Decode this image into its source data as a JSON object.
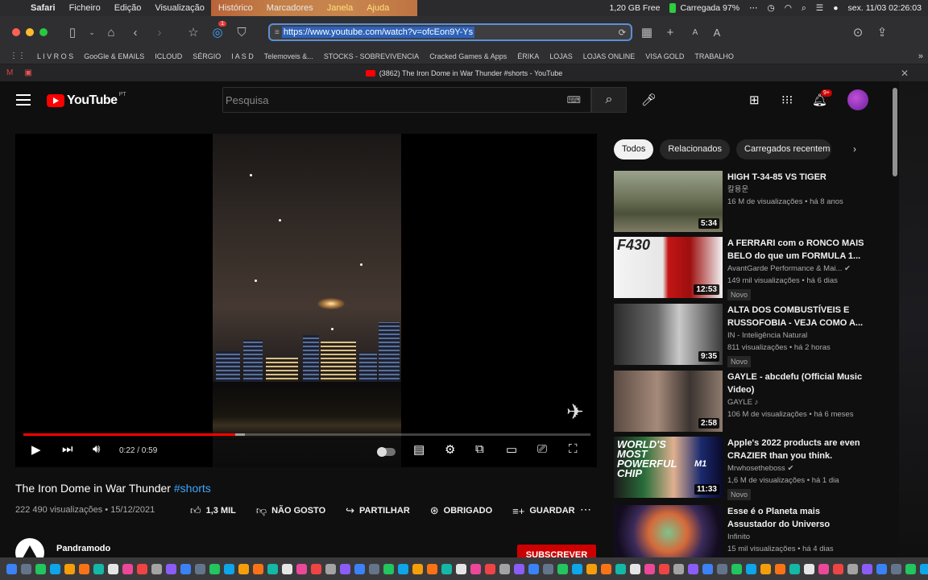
{
  "menubar": {
    "items": [
      "Safari",
      "Ficheiro",
      "Edição",
      "Visualização",
      "Histórico",
      "Marcadores",
      "Janela",
      "Ajuda"
    ],
    "memory": "1,20 GB Free",
    "battery": "Carregada 97%",
    "datetime": "sex. 11/03  02:26:03"
  },
  "toolbar": {
    "url": "https://www.youtube.com/watch?v=ofcEon9Y-Ys",
    "font_small": "A",
    "font_large": "A"
  },
  "bookmarks": [
    "L I V R O S",
    "GooGle & EMAILS",
    "ICLOUD",
    "SÉRGIO",
    "I A S D",
    "Telemoveis &...",
    "STOCKS - SOBREVIVENCIA",
    "Cracked Games & Apps",
    "ÉRIKA",
    "LOJAS",
    "LOJAS ONLINE",
    "VISA GOLD",
    "TRABALHO"
  ],
  "tab": {
    "title": "(3862) The Iron Dome in War Thunder #shorts - YouTube"
  },
  "yt": {
    "logo_text": "YouTube",
    "region": "PT",
    "search_placeholder": "Pesquisa",
    "notif_count": "9+"
  },
  "player": {
    "time": "0:22 / 0:59",
    "progress_played": 0.373,
    "progress_buffered": 0.39
  },
  "video": {
    "title": "The Iron Dome in War Thunder",
    "hashtag": "#shorts",
    "meta": "222 490 visualizações • 15/12/2021",
    "likes": "1,3 MIL",
    "dislike": "NÃO GOSTO",
    "share": "PARTILHAR",
    "thanks": "OBRIGADO",
    "save": "GUARDAR",
    "channel": "Pandramodo",
    "subscribe": "SUBSCREVER"
  },
  "chips": [
    "Todos",
    "Relacionados",
    "Carregados recentem"
  ],
  "recommendations": [
    {
      "title": "HIGH T-34-85 VS TIGER",
      "channel": "칼용운",
      "stats": "16 M de visualizações • há 8 anos",
      "duration": "5:34",
      "new": ""
    },
    {
      "title": "A FERRARI com o RONCO MAIS BELO do que um FORMULA 1...",
      "channel": "AvantGarde Performance & Mai... ✔",
      "stats": "149 mil visualizações • há 6 dias",
      "duration": "12:53",
      "new": "Novo",
      "thumb_text": "F430"
    },
    {
      "title": "ALTA DOS COMBUSTÍVEIS E RUSSOFOBIA - VEJA COMO A...",
      "channel": "IN - Inteligência Natural",
      "stats": "811 visualizações • há 2 horas",
      "duration": "9:35",
      "new": "Novo"
    },
    {
      "title": "GAYLE - abcdefu (Official Music Video)",
      "channel": "GAYLE ♪",
      "stats": "106 M de visualizações • há 6 meses",
      "duration": "2:58",
      "new": ""
    },
    {
      "title": "Apple's 2022 products are even CRAZIER than you think.",
      "channel": "Mrwhosetheboss ✔",
      "stats": "1,6 M de visualizações • há 1 dia",
      "duration": "11:33",
      "new": "Novo",
      "thumb_text": "WORLD'S MOST POWERFUL CHIP",
      "thumb_badge": "M1"
    },
    {
      "title": "Esse é o Planeta mais Assustador do Universo",
      "channel": "Infinito",
      "stats": "15 mil visualizações • há 4 dias",
      "duration": "",
      "new": ""
    }
  ],
  "colors": {
    "accent": "#ff0000",
    "bg": "#0f0f0f",
    "link": "#3ea6ff",
    "subscribe": "#cc0000"
  }
}
